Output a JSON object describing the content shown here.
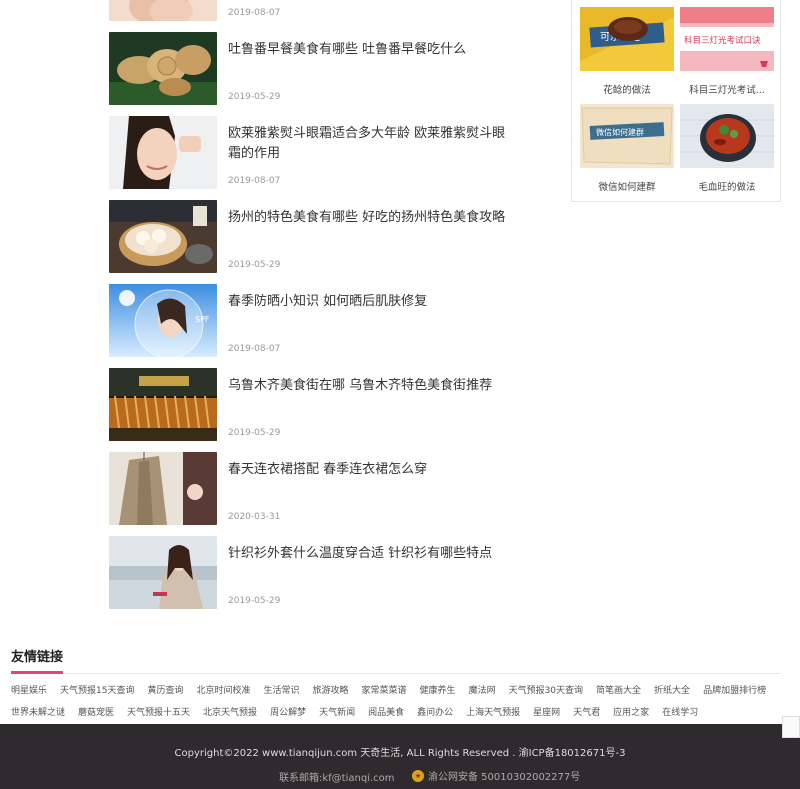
{
  "articles": [
    {
      "title": "",
      "date": "2019-08-07",
      "thumb_icon": "skincare-hands-image"
    },
    {
      "title": "吐鲁番早餐美食有哪些 吐鲁番早餐吃什么",
      "date": "2019-05-29",
      "thumb_icon": "naan-bread-image"
    },
    {
      "title": "欧莱雅紫熨斗眼霜适合多大年龄 欧莱雅紫熨斗眼霜的作用",
      "date": "2019-08-07",
      "thumb_icon": "woman-eye-cream-image"
    },
    {
      "title": "扬州的特色美食有哪些 好吃的扬州特色美食攻略",
      "date": "2019-05-29",
      "thumb_icon": "dim-sum-image"
    },
    {
      "title": "春季防晒小知识 如何晒后肌肤修复",
      "date": "2019-08-07",
      "thumb_icon": "sunscreen-woman-image"
    },
    {
      "title": "乌鲁木齐美食街在哪 乌鲁木齐特色美食街推荐",
      "date": "2019-05-29",
      "thumb_icon": "food-street-skewers-image"
    },
    {
      "title": "春天连衣裙搭配 春季连衣裙怎么穿",
      "date": "2020-03-31",
      "thumb_icon": "coat-dress-image"
    },
    {
      "title": "针织衫外套什么温度穿合适 针织衫有哪些特点",
      "date": "2019-05-29",
      "thumb_icon": "knit-cardigan-woman-image"
    }
  ],
  "side_cards": [
    {
      "caption": "花鲶的做法",
      "banner": "可乐鸡翅"
    },
    {
      "caption": "科目三灯光考试...",
      "banner": "科目三灯光考试口诀"
    },
    {
      "caption": "微信如何建群",
      "banner": "微信如何建群"
    },
    {
      "caption": "毛血旺的做法",
      "banner": ""
    }
  ],
  "links": {
    "title": "友情链接",
    "row1": [
      "明星娱乐",
      "天气预报15天查询",
      "黄历查询",
      "北京时间校准",
      "生活常识",
      "旅游攻略",
      "家常菜菜谱",
      "健康养生",
      "魔法网",
      "天气预报30天查询",
      "简笔画大全",
      "折纸大全",
      "品牌加盟排行榜"
    ],
    "row2": [
      "世界未解之谜",
      "蘑菇宠医",
      "天气预报十五天",
      "北京天气预报",
      "周公解梦",
      "天气新闻",
      "阅品美食",
      "鑫问办公",
      "上海天气预报",
      "星座网",
      "天气君",
      "应用之家",
      "在线学习"
    ]
  },
  "footer": {
    "copyright": "Copyright©2022 www.tianqijun.com 天奇生活, ALL Rights Reserved . 渝ICP备18012671号-3",
    "contact": "联系邮箱:kf@tianqi.com",
    "police": "渝公网安备 50010302002277号"
  },
  "colors": {
    "accent": "#e0457b",
    "footer_bg": "#2f2a2d"
  }
}
